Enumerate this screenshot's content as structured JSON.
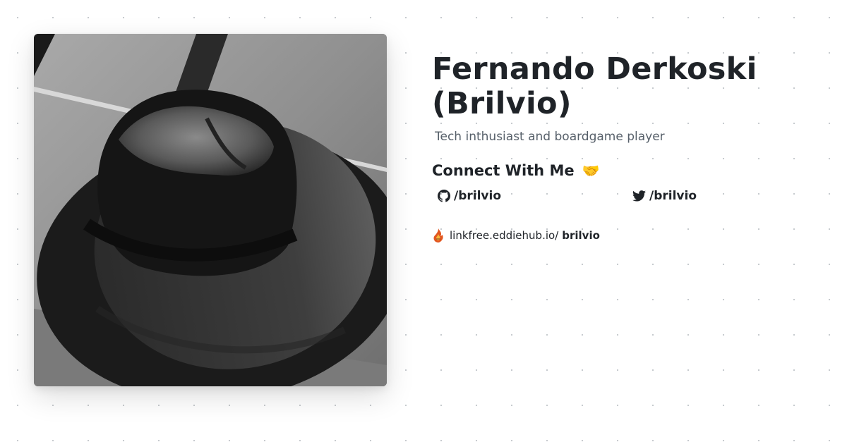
{
  "profile": {
    "name_line1": "Fernando Derkoski",
    "name_line2": "(Brilvio)",
    "tagline": "Tech inthusiast and boardgame player",
    "avatar_icon": "fedora-hat-photo"
  },
  "connect": {
    "heading": "Connect With Me",
    "heading_emoji": "🤝",
    "github": {
      "icon": "github-icon",
      "label": "/brilvio"
    },
    "twitter": {
      "icon": "twitter-icon",
      "label": "/brilvio"
    }
  },
  "linkfree": {
    "icon": "flame-logo-icon",
    "domain": "linkfree.eddiehub.io/",
    "handle": "brilvio"
  },
  "colors": {
    "text": "#1f2328",
    "muted": "#57606a",
    "dots": "#c4c8cc"
  }
}
